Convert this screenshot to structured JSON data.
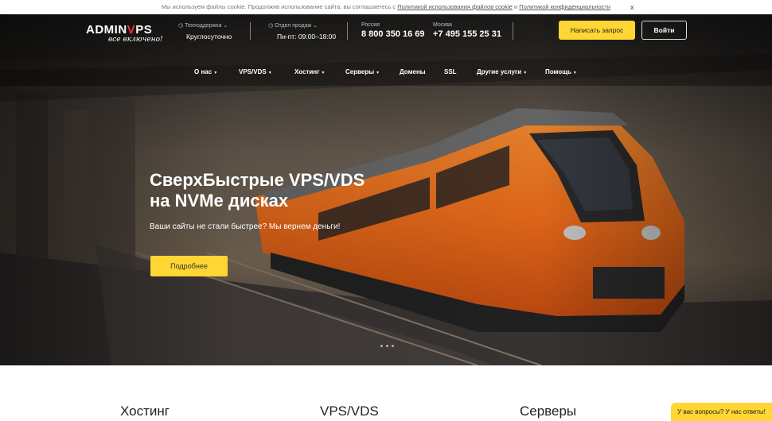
{
  "cookie": {
    "text_before": "Мы используем файлы cookie. Продолжив использование сайта, вы соглашаетесь с ",
    "link1": "Политикой использования файлов cookie",
    "and": " и ",
    "link2": "Политикой конфиденциальности",
    "close": "x"
  },
  "logo": {
    "main_prefix": "ADMIN",
    "main_v": "V",
    "main_suffix": "PS",
    "tagline": "все включено!"
  },
  "header": {
    "support": {
      "label": "Техподдержка",
      "value": "Круглосуточно"
    },
    "sales": {
      "label": "Отдел продаж",
      "value": "Пн-пт: 09:00–18:00"
    },
    "russia": {
      "label": "Россия",
      "phone": "8 800 350 16 69"
    },
    "moscow": {
      "label": "Москва",
      "phone": "+7 495 155 25 31"
    },
    "request_button": "Написать запрос",
    "login_button": "Войти"
  },
  "nav": {
    "about": "О нас",
    "vps": "VPS/VDS",
    "hosting": "Хостинг",
    "servers": "Серверы",
    "domains": "Домены",
    "ssl": "SSL",
    "other": "Другие услуги",
    "help": "Помощь"
  },
  "hero": {
    "title_line1": "СверхБыстрые VPS/VDS",
    "title_line2": "на NVMe дисках",
    "subtitle": "Ваши сайты не стали быстрее? Мы вернем деньги!",
    "button": "Подробнее"
  },
  "sections": {
    "hosting": "Хостинг",
    "vps": "VPS/VDS",
    "servers": "Серверы"
  },
  "chat": {
    "label": "У вас вопросы? У нас ответы!"
  },
  "colors": {
    "accent": "#ffd633",
    "logo_v": "#e33333",
    "train": "#e86a1a"
  }
}
